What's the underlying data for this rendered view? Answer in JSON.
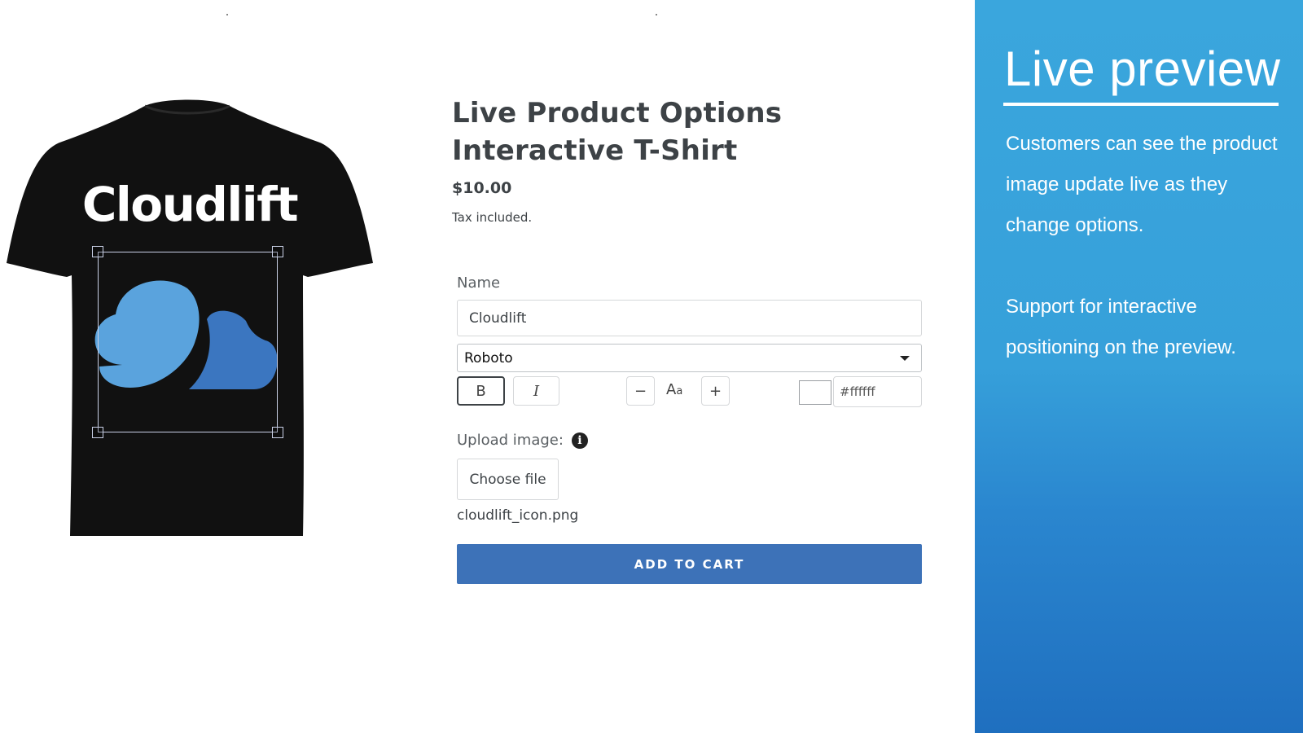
{
  "preview": {
    "shirt_text": "Cloudlift",
    "shirt_color": "#111111",
    "text_color": "#ffffff",
    "logo_colors": [
      "#5aa3dd",
      "#3b76c0"
    ]
  },
  "product": {
    "title_line1": "Live Product Options",
    "title_line2": "Interactive T-Shirt",
    "price": "$10.00",
    "tax_note": "Tax included."
  },
  "form": {
    "name_label": "Name",
    "name_value": "Cloudlift",
    "font_value": "Roboto",
    "bold_label": "B",
    "italic_label": "I",
    "minus_label": "−",
    "plus_label": "+",
    "size_icon": "text-size-icon",
    "color_value": "#ffffff",
    "upload_label": "Upload image:",
    "info_icon": "info-icon",
    "choose_file_label": "Choose file",
    "file_name": "cloudlift_icon.png",
    "add_to_cart_label": "ADD TO CART",
    "accent_color": "#3d72b8"
  },
  "promo": {
    "title": "Live preview",
    "text_1": "Customers can see the product image update live as they change options.",
    "text_2": "Support for interactive positioning on the preview.",
    "background_top": "#3aa6dd",
    "background_bottom": "#1f6fbf"
  }
}
